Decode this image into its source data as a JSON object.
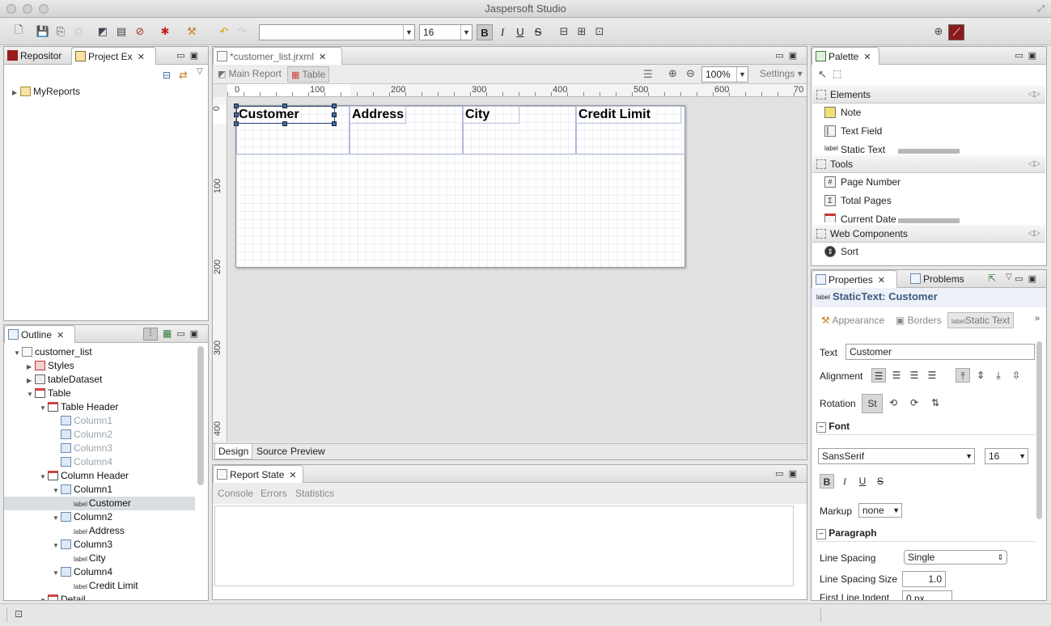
{
  "app": {
    "title": "Jaspersoft Studio"
  },
  "toolbar": {
    "font_name": "",
    "font_size": "16",
    "bold": "B",
    "italic": "I",
    "underline": "U",
    "strike": "S"
  },
  "repo_panel": {
    "tab_repository": "Repositor",
    "tab_project": "Project Ex",
    "tree_root": "MyReports"
  },
  "outline": {
    "tab": "Outline",
    "items": [
      {
        "label": "customer_list"
      },
      {
        "label": "Styles"
      },
      {
        "label": "tableDataset"
      },
      {
        "label": "Table"
      },
      {
        "label": "Table Header"
      },
      {
        "label": "Column1"
      },
      {
        "label": "Column2"
      },
      {
        "label": "Column3"
      },
      {
        "label": "Column4"
      },
      {
        "label": "Column Header"
      },
      {
        "label": "Column1"
      },
      {
        "label": "Customer",
        "tag": "label"
      },
      {
        "label": "Column2"
      },
      {
        "label": "Address",
        "tag": "label"
      },
      {
        "label": "Column3"
      },
      {
        "label": "City",
        "tag": "label"
      },
      {
        "label": "Column4"
      },
      {
        "label": "Credit Limit",
        "tag": "label"
      },
      {
        "label": "Detail"
      }
    ]
  },
  "editor": {
    "file_tab": "*customer_list.jrxml",
    "crumb_main": "Main Report",
    "crumb_table": "Table",
    "zoom": "100%",
    "settings": "Settings",
    "ruler_h": [
      "0",
      "100",
      "200",
      "300",
      "400",
      "500",
      "600",
      "70"
    ],
    "ruler_v": [
      "0",
      "100",
      "200",
      "300",
      "400"
    ],
    "columns": [
      "Customer",
      "Address",
      "City",
      "Credit Limit"
    ],
    "bottom_tabs": [
      "Design",
      "Source",
      "Preview"
    ]
  },
  "report_state": {
    "tab": "Report State",
    "subtabs": [
      "Console",
      "Errors",
      "Statistics"
    ]
  },
  "palette": {
    "tab": "Palette",
    "sections": [
      {
        "title": "Elements",
        "items": [
          "Note",
          "Text Field",
          "Static Text"
        ]
      },
      {
        "title": "Tools",
        "items": [
          "Page Number",
          "Total Pages",
          "Current Date"
        ]
      },
      {
        "title": "Web Components",
        "items": [
          "Sort"
        ]
      }
    ]
  },
  "properties": {
    "tab_properties": "Properties",
    "tab_problems": "Problems",
    "header": "StaticText: Customer",
    "header_tag": "label",
    "subtabs": [
      "Appearance",
      "Borders",
      "Static Text"
    ],
    "text_label": "Text",
    "text_value": "Customer",
    "alignment_label": "Alignment",
    "rotation_label": "Rotation",
    "font_section": "Font",
    "font_name": "SansSerif",
    "font_size": "16",
    "markup_label": "Markup",
    "markup_value": "none",
    "paragraph_section": "Paragraph",
    "line_spacing_label": "Line Spacing",
    "line_spacing_value": "Single",
    "line_spacing_size_label": "Line Spacing Size",
    "line_spacing_size_value": "1.0",
    "first_indent_label": "First Line Indent",
    "first_indent_value": "0 px"
  }
}
